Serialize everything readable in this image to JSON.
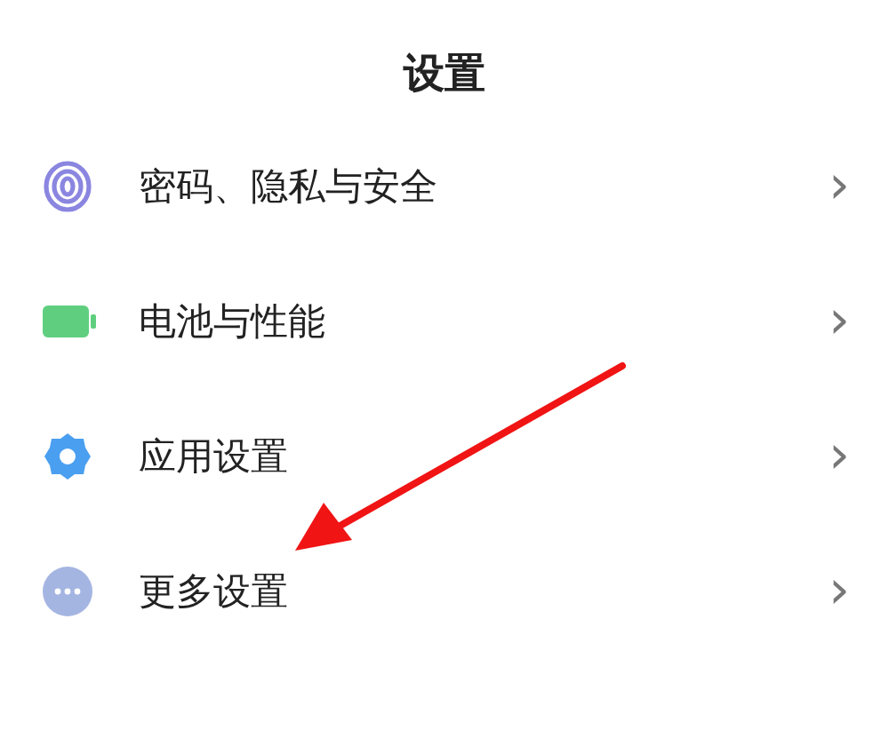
{
  "header": {
    "title": "设置"
  },
  "items": [
    {
      "kind": "fingerprint",
      "label": "密码、隐私与安全",
      "chevron": "›"
    },
    {
      "kind": "battery",
      "label": "电池与性能",
      "chevron": "›"
    },
    {
      "kind": "gear",
      "label": "应用设置",
      "chevron": "›"
    },
    {
      "kind": "more",
      "label": "更多设置",
      "chevron": "›"
    }
  ]
}
